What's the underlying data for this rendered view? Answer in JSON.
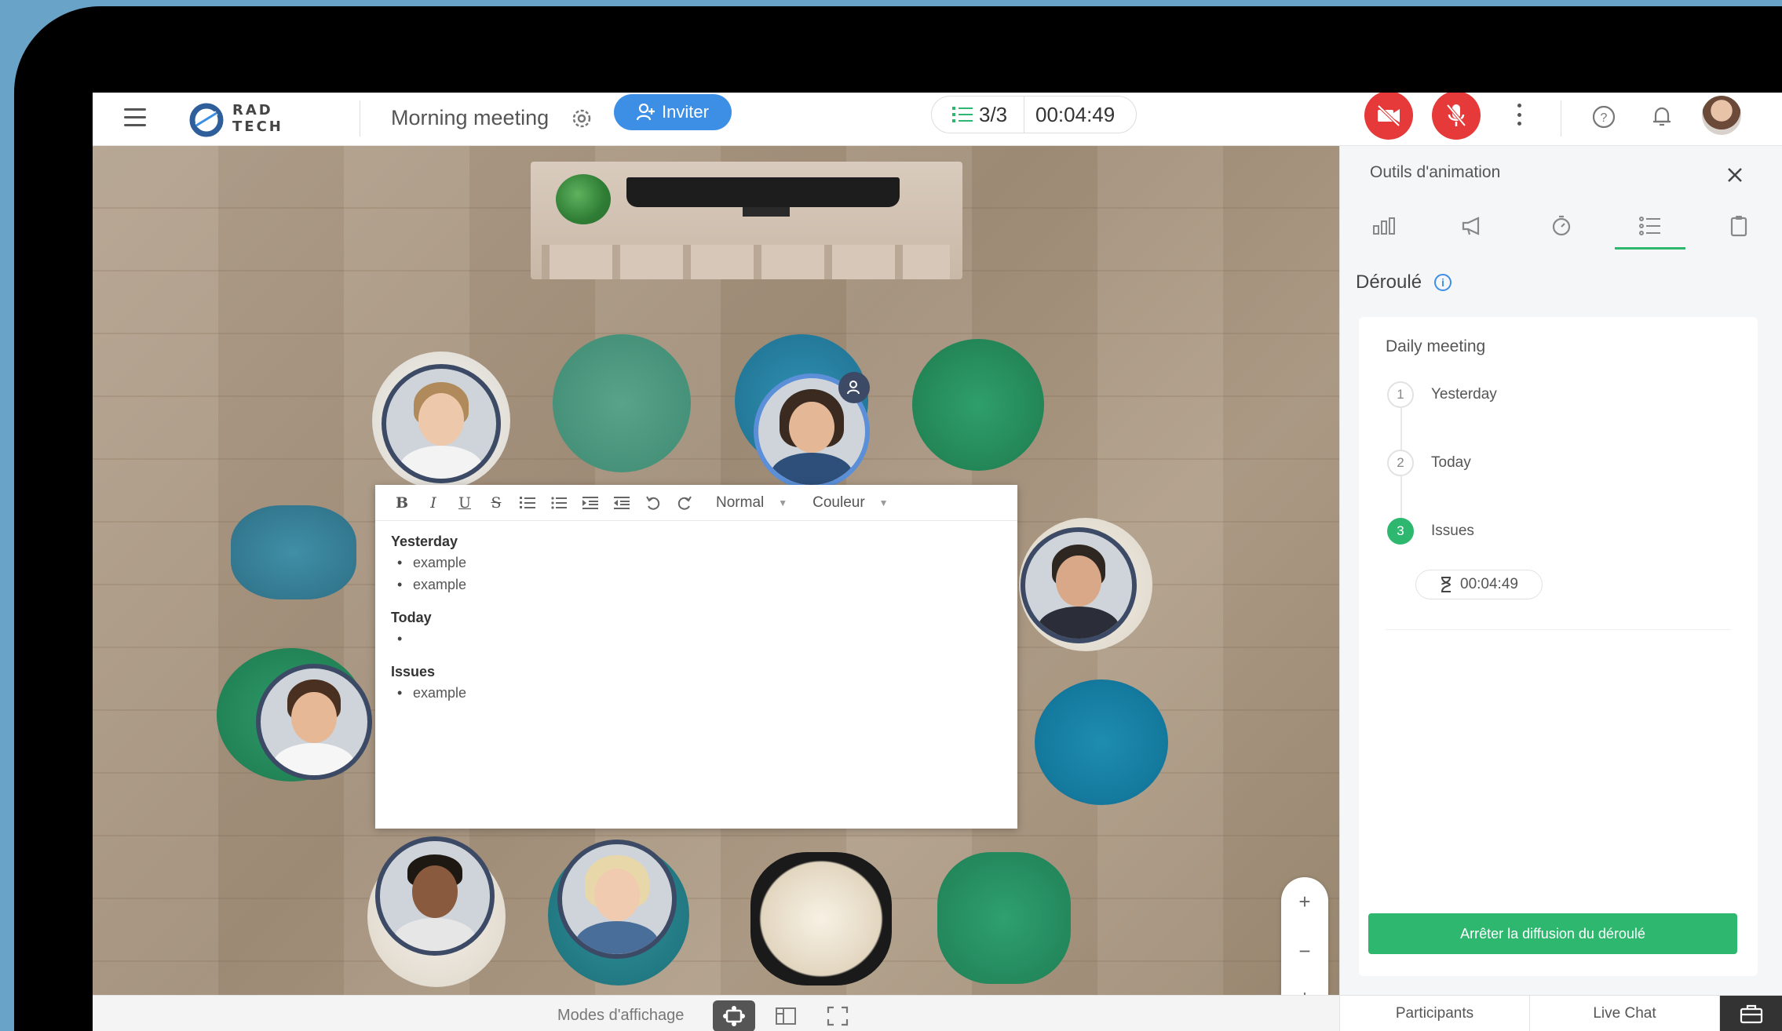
{
  "app": {
    "logo_text_line1": "RAD",
    "logo_text_line2": "TECH",
    "meeting_title": "Morning meeting",
    "invite_label": "Inviter",
    "agenda_progress": "3/3",
    "elapsed_time": "00:04:49"
  },
  "colors": {
    "accent_blue": "#3d8fe6",
    "accent_green": "#2eb86f",
    "danger_red": "#e63939",
    "device_bg": "#6aa3c8"
  },
  "editor": {
    "format_select": "Normal",
    "color_select": "Couleur",
    "sections": [
      {
        "heading": "Yesterday",
        "items": [
          "example",
          "example"
        ]
      },
      {
        "heading": "Today",
        "items": [
          ""
        ]
      },
      {
        "heading": "Issues",
        "items": [
          "example"
        ]
      }
    ]
  },
  "bottom_bar": {
    "modes_label": "Modes d'affichage"
  },
  "panel": {
    "title": "Outils d'animation",
    "section_title": "Déroulé",
    "card_title": "Daily meeting",
    "steps": [
      {
        "number": "1",
        "label": "Yesterday"
      },
      {
        "number": "2",
        "label": "Today"
      },
      {
        "number": "3",
        "label": "Issues"
      }
    ],
    "step_timer": "00:04:49",
    "stop_button": "Arrêter la diffusion du déroulé",
    "bottom_tabs": [
      "Participants",
      "Live Chat"
    ]
  }
}
